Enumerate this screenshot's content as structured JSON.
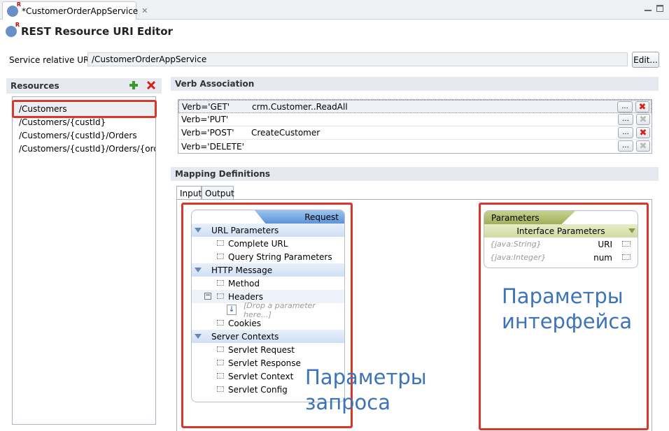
{
  "tab": {
    "title": "*CustomerOrderAppService"
  },
  "editor": {
    "title": "REST Resource URI Editor"
  },
  "service": {
    "label": "Service relative URI:",
    "value": "/CustomerOrderAppService",
    "edit_button": "Edit..."
  },
  "resources": {
    "header": "Resources",
    "items": [
      "/Customers",
      "/Customers/{custId}",
      "/Customers/{custId}/Orders",
      "/Customers/{custId}/Orders/{orde..."
    ]
  },
  "verb_association": {
    "header": "Verb Association",
    "rows": [
      {
        "verb": "Verb='GET'",
        "value": "crm.Customer..ReadAll"
      },
      {
        "verb": "Verb='PUT'",
        "value": ""
      },
      {
        "verb": "Verb='POST'",
        "value": "CreateCustomer"
      },
      {
        "verb": "Verb='DELETE'",
        "value": ""
      }
    ],
    "browse_label": "..."
  },
  "mapping": {
    "header": "Mapping Definitions",
    "tabs": [
      "Input",
      "Output"
    ]
  },
  "request": {
    "title": "Request",
    "groups": [
      {
        "label": "URL Parameters",
        "items": [
          "Complete URL",
          "Query String Parameters"
        ]
      },
      {
        "label": "HTTP Message",
        "items": [
          "Method",
          "Headers",
          "[Drop a parameter here...]",
          "Cookies"
        ]
      },
      {
        "label": "Server Contexts",
        "items": [
          "Servlet Request",
          "Servlet Response",
          "Servlet Context",
          "Servlet Config"
        ]
      }
    ]
  },
  "parameters": {
    "title": "Parameters",
    "subheader": "Interface Parameters",
    "rows": [
      {
        "type": "{java:String}",
        "name": "URI"
      },
      {
        "type": "{java:Integer}",
        "name": "num"
      }
    ]
  },
  "annotations": {
    "request_params": "Параметры запроса",
    "interface_params": "Параметры интерфейса"
  },
  "colors": {
    "accent": "#3d74b8",
    "highlight": "#d9362c",
    "params_header": "#9fb05a"
  }
}
